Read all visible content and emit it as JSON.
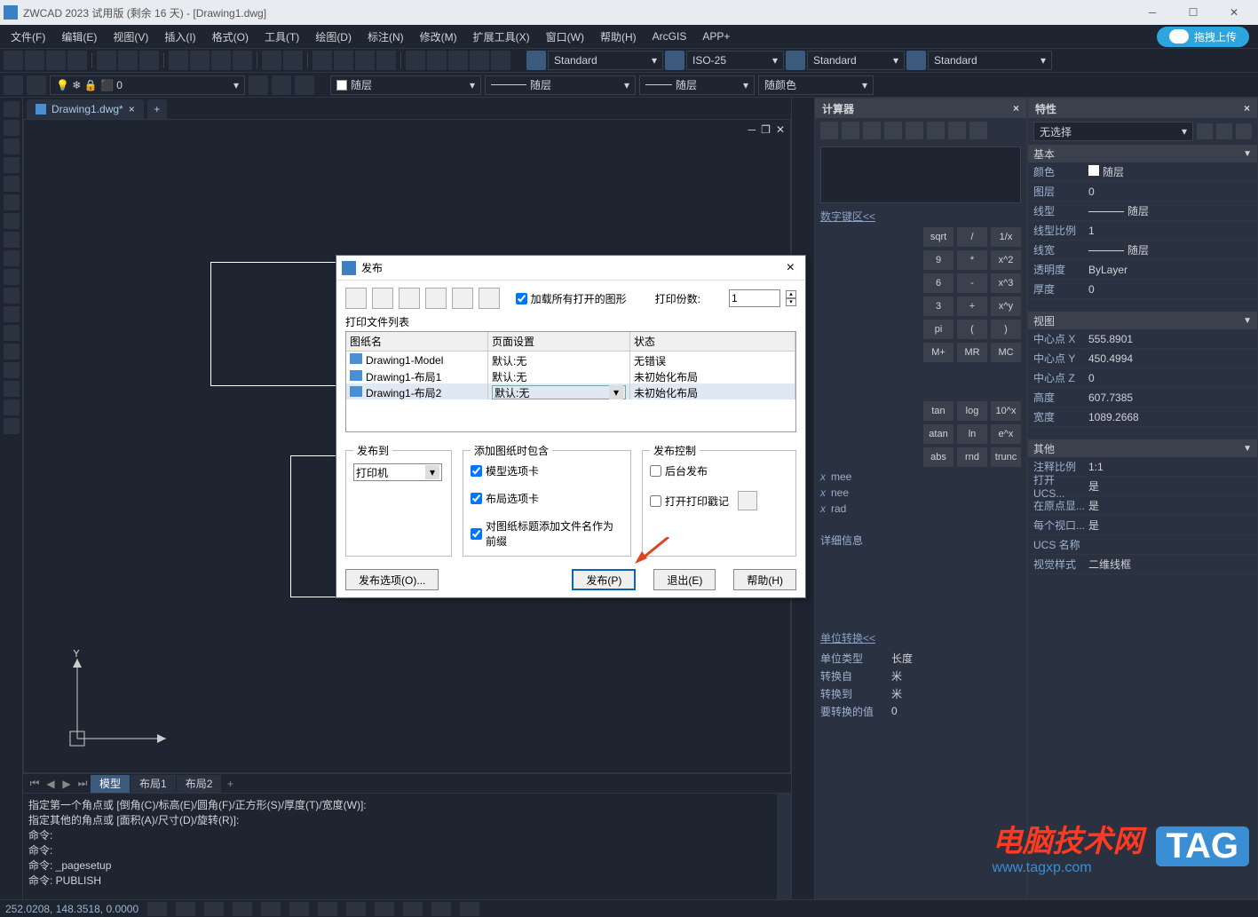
{
  "title": "ZWCAD 2023 试用版 (剩余 16 天) - [Drawing1.dwg]",
  "menu": [
    "文件(F)",
    "编辑(E)",
    "视图(V)",
    "插入(I)",
    "格式(O)",
    "工具(T)",
    "绘图(D)",
    "标注(N)",
    "修改(M)",
    "扩展工具(X)",
    "窗口(W)",
    "帮助(H)",
    "ArcGIS",
    "APP+"
  ],
  "upload": "拖拽上传",
  "layer_dd": "随层",
  "ltype_dd": "随层",
  "lweight_dd": "随层",
  "color_dd": "随颜色",
  "std1": "Standard",
  "std2": "ISO-25",
  "std3": "Standard",
  "std4": "Standard",
  "filetab": "Drawing1.dwg*",
  "bottom_tabs": [
    "模型",
    "布局1",
    "布局2"
  ],
  "cmd_lines": [
    "指定第一个角点或 [倒角(C)/标高(E)/圆角(F)/正方形(S)/厚度(T)/宽度(W)]:",
    "指定其他的角点或 [面积(A)/尺寸(D)/旋转(R)]:",
    "命令:",
    "命令:",
    "命令: _pagesetup",
    "命令: PUBLISH"
  ],
  "status_coord": "252.0208, 148.3518, 0.0000",
  "calc": {
    "title": "计算器",
    "numpad": "数字键区<<",
    "buttons1": [
      "sqrt",
      "/",
      "1/x"
    ],
    "buttons2": [
      "9",
      "*",
      "x^2"
    ],
    "buttons3": [
      "6",
      "-",
      "x^3"
    ],
    "buttons4": [
      "3",
      "+",
      "x^y"
    ],
    "buttons5": [
      "pi",
      "(",
      ")"
    ],
    "buttons6": [
      "M+",
      "MR",
      "MC"
    ],
    "sci": [
      "tan",
      "log",
      "10^x"
    ],
    "sci2": [
      "atan",
      "ln",
      "e^x"
    ],
    "sci3": [
      "abs",
      "rnd",
      "trunc"
    ],
    "vars": [
      "mee",
      "nee",
      "rad"
    ],
    "detail": "详细信息",
    "unit": "单位转换<<",
    "unit_rows": [
      [
        "单位类型",
        "长度"
      ],
      [
        "转换自",
        "米"
      ],
      [
        "转换到",
        "米"
      ],
      [
        "要转换的值",
        "0"
      ]
    ]
  },
  "props": {
    "title": "特性",
    "nosel": "无选择",
    "g_basic": "基本",
    "basic": [
      [
        "颜色",
        "随层",
        "swatch"
      ],
      [
        "图层",
        "0",
        ""
      ],
      [
        "线型",
        "随层",
        "line"
      ],
      [
        "线型比例",
        "1",
        ""
      ],
      [
        "线宽",
        "随层",
        "line"
      ],
      [
        "透明度",
        "ByLayer",
        ""
      ],
      [
        "厚度",
        "0",
        ""
      ]
    ],
    "g_view": "视图",
    "view": [
      [
        "中心点 X",
        "555.8901"
      ],
      [
        "中心点 Y",
        "450.4994"
      ],
      [
        "中心点 Z",
        "0"
      ],
      [
        "高度",
        "607.7385"
      ],
      [
        "宽度",
        "1089.2668"
      ]
    ],
    "g_other": "其他",
    "other": [
      [
        "注释比例",
        "1:1"
      ],
      [
        "打开 UCS...",
        "是"
      ],
      [
        "在原点显...",
        "是"
      ],
      [
        "每个视口...",
        "是"
      ],
      [
        "UCS 名称",
        ""
      ],
      [
        "视觉样式",
        "二维线框"
      ]
    ]
  },
  "dlg": {
    "title": "发布",
    "load_all": "加载所有打开的图形",
    "copies_lbl": "打印份数:",
    "copies": "1",
    "list_lbl": "打印文件列表",
    "cols": [
      "图纸名",
      "页面设置",
      "状态"
    ],
    "rows": [
      [
        "Drawing1-Model",
        "默认:无",
        "无错误"
      ],
      [
        "Drawing1-布局1",
        "默认:无",
        "未初始化布局"
      ],
      [
        "Drawing1-布局2",
        "默认:无",
        "未初始化布局"
      ]
    ],
    "pub_to": "发布到",
    "pub_to_val": "打印机",
    "add_incl": "添加图纸时包含",
    "chk_model": "模型选项卡",
    "chk_layout": "布局选项卡",
    "chk_prefix": "对图纸标题添加文件名作为前缀",
    "pub_ctrl": "发布控制",
    "chk_bg": "后台发布",
    "chk_stamp": "打开打印戳记",
    "btn_opt": "发布选项(O)...",
    "btn_pub": "发布(P)",
    "btn_exit": "退出(E)",
    "btn_help": "帮助(H)"
  },
  "wm": {
    "t1": "电脑技术网",
    "t2": "www.tagxp.com",
    "tag": "TAG"
  }
}
